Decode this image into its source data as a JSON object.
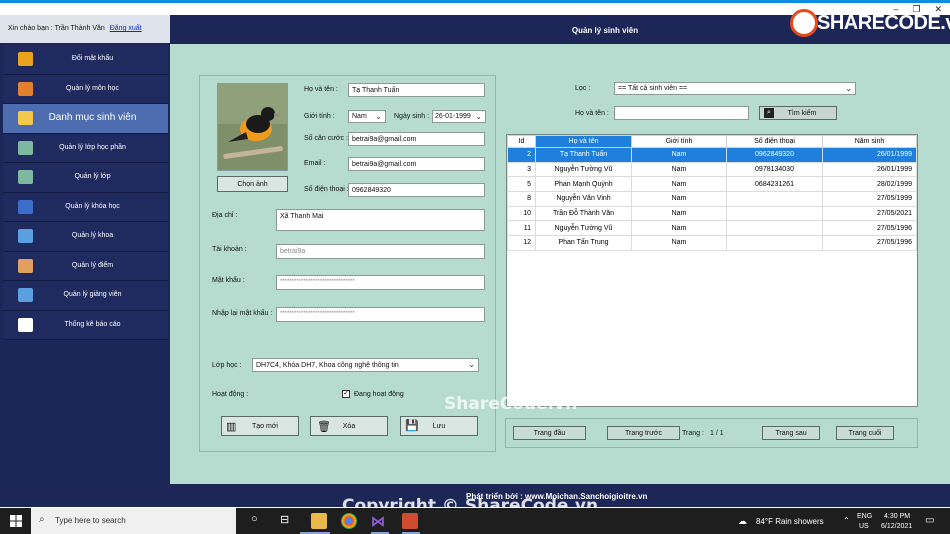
{
  "window": {
    "controls": [
      "–",
      "❐",
      "✕"
    ]
  },
  "greeting": {
    "text": "Xin chào bạn : Trần Thành Văn",
    "logout": "Đăng xuất"
  },
  "header": {
    "title": "Quản lý sinh viên",
    "logo": "SHARECODE.vn"
  },
  "menu": [
    {
      "label": "Đổi mật khẩu",
      "icon": "lock-icon",
      "color": "#e8a21b"
    },
    {
      "label": "Quản lý môn học",
      "icon": "book-icon",
      "color": "#e08030"
    },
    {
      "label": "Danh mục sinh viên",
      "icon": "student-icon",
      "color": "#f2c94c",
      "active": true
    },
    {
      "label": "Quản lý lớp học phần",
      "icon": "chart-icon",
      "color": "#7fb8a0"
    },
    {
      "label": "Quản lý lớp",
      "icon": "chart-icon",
      "color": "#7fb8a0"
    },
    {
      "label": "Quản lý khóa học",
      "icon": "books-icon",
      "color": "#3b6fc9"
    },
    {
      "label": "Quản lý khoa",
      "icon": "open-book-icon",
      "color": "#5aa0e0"
    },
    {
      "label": "Quản lý điểm",
      "icon": "clipboard-icon",
      "color": "#e0a060"
    },
    {
      "label": "Quản lý giảng viên",
      "icon": "teacher-icon",
      "color": "#5aa0e0"
    },
    {
      "label": "Thống kê báo cáo",
      "icon": "report-icon",
      "color": "#ffffff"
    }
  ],
  "form": {
    "choose_image": "Chọn ảnh",
    "name_label": "Họ và tên  :",
    "name_value": "Tạ Thanh Tuấn",
    "gender_label": "Giới tính :",
    "gender_value": "Nam",
    "dob_label": "Ngày sinh  :",
    "dob_value": "26-01-1999",
    "id_label": "Số căn cước  :",
    "id_value": "betrai9a@gmail.com",
    "email_label": "Email  :",
    "email_value": "betrai9a@gmail.com",
    "phone_label": "Số điện thoại  :",
    "phone_value": "0962849320",
    "address_label": "Địa chỉ  :",
    "address_value": "Xã Thanh Mai",
    "account_label": "Tài khoản  :",
    "account_value": "betrai9a",
    "password_label": "Mật khẩu  :",
    "password_value": "********************************",
    "repassword_label": "Nhập lại mật khẩu  :",
    "repassword_value": "********************************",
    "class_label": "Lớp học  :",
    "class_value": "DH7C4, Khóa DH7, Khoa công nghệ thông tin",
    "active_label": "Hoạt động  :",
    "active_check_label": "Đang hoạt động",
    "active_checked": true,
    "btn_new": "Tạo mới",
    "btn_delete": "Xóa",
    "btn_save": "Lưu"
  },
  "filter": {
    "label": "Lọc  :",
    "value": "== Tất cả sinh viên ==",
    "name_label": "Họ và tên  :",
    "search_button": "Tìm kiếm"
  },
  "table": {
    "columns": [
      "Id",
      "Họ và tên",
      "Giới tính",
      "Số điện thoại",
      "Năm sinh"
    ],
    "rows": [
      [
        "2",
        "Tạ Thanh Tuấn",
        "Nam",
        "0962849320",
        "26/01/1999"
      ],
      [
        "3",
        "Nguyễn Tường Vũ",
        "Nam",
        "0978134030",
        "26/01/1999"
      ],
      [
        "5",
        "Phan Mạnh Quỳnh",
        "Nam",
        "0684231261",
        "28/02/1999"
      ],
      [
        "8",
        "Nguyễn Văn Vinh",
        "Nam",
        "",
        "27/05/1999"
      ],
      [
        "10",
        "Trần Đỗ Thành Văn",
        "Nam",
        "",
        "27/05/2021"
      ],
      [
        "11",
        "Nguyễn Tường Vũ",
        "Nam",
        "",
        "27/05/1996"
      ],
      [
        "12",
        "Phan Tấn Trung",
        "Nam",
        "",
        "27/05/1996"
      ]
    ]
  },
  "pager": {
    "first": "Trang đầu",
    "prev": "Trang trước",
    "label": "Trang :",
    "value": "1 / 1",
    "next": "Trang sau",
    "last": "Trang cuối"
  },
  "footer": {
    "text": "Phát triển bởi : www.Moichan.Sanchoigioitre.vn"
  },
  "watermarks": {
    "mid": "ShareCode.vn",
    "bottom": "Copyright © ShareCode.vn"
  },
  "taskbar": {
    "search_placeholder": "Type here to search",
    "weather": "84°F  Rain showers",
    "lang": "ENG",
    "region": "US",
    "time": "4:30 PM",
    "date": "6/12/2021"
  }
}
